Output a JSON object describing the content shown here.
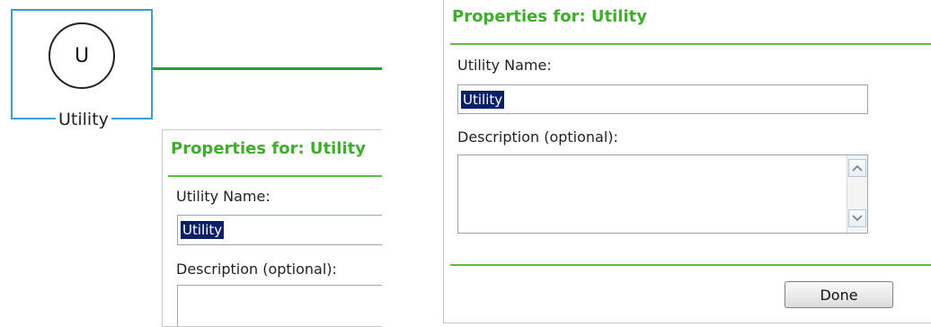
{
  "node": {
    "icon_letter": "U",
    "label": "Utility"
  },
  "panel_back": {
    "title": "Properties for: Utility",
    "name_label": "Utility Name:",
    "name_value": "Utility",
    "description_label": "Description (optional):"
  },
  "panel_front": {
    "title": "Properties for: Utility",
    "name_label": "Utility Name:",
    "name_value": "Utility",
    "description_label": "Description (optional):",
    "description_value": "",
    "done_label": "Done"
  },
  "colors": {
    "title_green": "#3fae2a",
    "rule_green": "#5cbf3f",
    "selection_navy": "#0a1f66",
    "node_border_blue": "#3a9fd3",
    "connector_green": "#2f9a3c"
  },
  "icons": [
    "scroll-up-icon",
    "scroll-down-icon"
  ]
}
